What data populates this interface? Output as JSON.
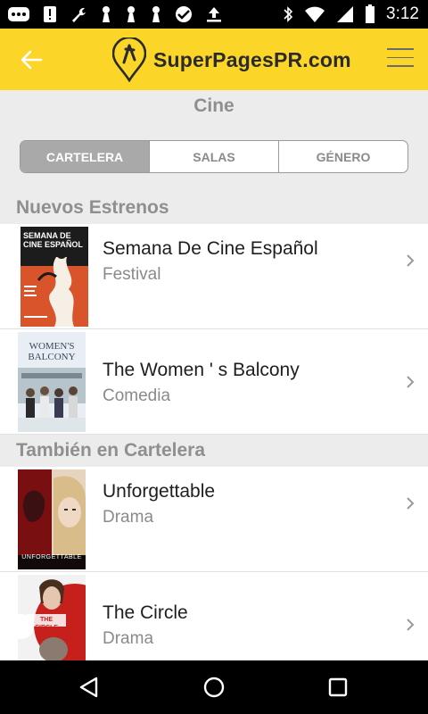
{
  "status_bar": {
    "time": "3:12",
    "left_icons": [
      "messaging-icon",
      "alert-icon",
      "wrench-icon",
      "chess-pawn-icon",
      "chess-pawn-icon",
      "chess-pawn-icon",
      "heart-monitor-icon",
      "download-icon"
    ],
    "right_icons": [
      "bluetooth-icon",
      "wifi-icon",
      "signal-icon",
      "battery-icon"
    ]
  },
  "header": {
    "logo_text": "SuperPagesPR.com",
    "back_icon": "back-arrow-icon",
    "menu_icon": "hamburger-menu-icon",
    "accent_color": "#fbd629"
  },
  "page": {
    "title": "Cine"
  },
  "tabs": [
    {
      "label": "CARTELERA",
      "active": true
    },
    {
      "label": "SALAS",
      "active": false
    },
    {
      "label": "GÉNERO",
      "active": false
    }
  ],
  "sections": [
    {
      "title": "Nuevos Estrenos",
      "movies": [
        {
          "title": "Semana De Cine Español",
          "genre": "Festival"
        },
        {
          "title": "The Women ' s Balcony",
          "genre": "Comedia"
        }
      ]
    },
    {
      "title": "También en Cartelera",
      "movies": [
        {
          "title": "Unforgettable",
          "genre": "Drama"
        },
        {
          "title": "The Circle",
          "genre": "Drama"
        }
      ]
    }
  ],
  "posters": {
    "poster1_text": "SEMANA DE CINE ESPAÑOL",
    "poster2_text": "WOMEN'S BALCONY",
    "poster3_text": "UNFORGETTABLE",
    "poster4_text": "THE CIRCLE"
  },
  "nav_bar": {
    "icons": [
      "back-triangle-icon",
      "home-circle-icon",
      "recents-square-icon"
    ]
  }
}
